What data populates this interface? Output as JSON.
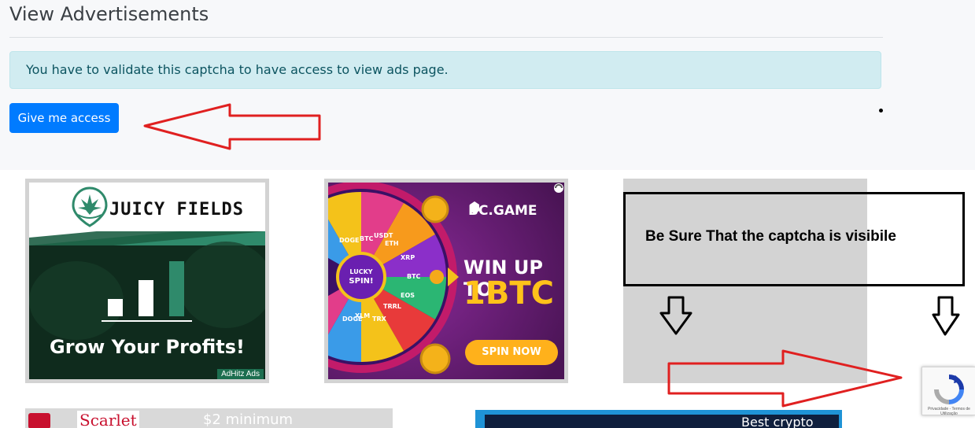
{
  "header": {
    "title": "View Advertisements"
  },
  "alert": {
    "message": "You have to validate this captcha to have access to view ads page."
  },
  "actions": {
    "access_button_label": "Give me access"
  },
  "ads": [
    {
      "brand": "JUICY FIELDS",
      "headline": "Grow Your Profits!",
      "badge": "AdHitz Ads"
    },
    {
      "brand": "BC.GAME",
      "headline_line1": "WIN UP TO",
      "headline_line2": "1BTC",
      "wheel_center": "LUCKY SPIN!",
      "cta": "SPIN NOW",
      "wheel_labels": [
        "BTC",
        "USDT",
        "ETH",
        "XRP",
        "BTC",
        "EOS",
        "TRRL",
        "TRX",
        "XLM",
        "DOGE",
        "DOGE"
      ]
    }
  ],
  "annotation": {
    "note": "Be Sure That the captcha is visibile"
  },
  "recaptcha": {
    "fine_print": "Privacidade - Termos de Utilização"
  },
  "bottom_ads": [
    {
      "brand": "Scarlet",
      "text": "$2 minimum"
    },
    {
      "text": "Best crypto"
    }
  ],
  "colors": {
    "primary": "#007bff",
    "alert_bg": "#d1ecf1",
    "alert_text": "#0c5460",
    "arrow_red": "#e02020",
    "juicy_green": "#2f8a6b",
    "bcgame_purple": "#6b1f78",
    "bcgame_yellow": "#ffc21a"
  }
}
